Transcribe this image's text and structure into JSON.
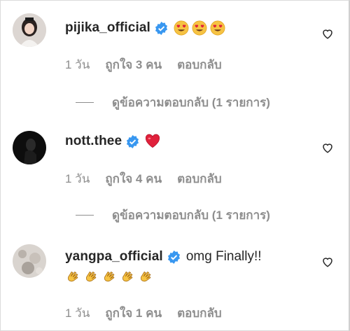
{
  "colors": {
    "verified": "#3897f0",
    "text": "#262626",
    "secondary": "#8e8e8e",
    "heart_emoji": "#e0213b",
    "clap_emoji": "#f6c343"
  },
  "comments": [
    {
      "username": "pijika_official",
      "verified": true,
      "text": "",
      "emoji": [
        "heart-eyes-emoji",
        "heart-eyes-emoji",
        "heart-eyes-emoji"
      ],
      "time": "1 วัน",
      "likes": "ถูกใจ 3 คน",
      "reply_label": "ตอบกลับ",
      "view_replies": "ดูข้อความตอบกลับ (1 รายการ)"
    },
    {
      "username": "nott.thee",
      "verified": true,
      "text": "",
      "emoji": [
        "red-heart-emoji"
      ],
      "time": "1 วัน",
      "likes": "ถูกใจ 4 คน",
      "reply_label": "ตอบกลับ",
      "view_replies": "ดูข้อความตอบกลับ (1 รายการ)"
    },
    {
      "username": "yangpa_official",
      "verified": true,
      "text": "omg Finally!!",
      "emoji": [
        "clapping-hands-emoji",
        "clapping-hands-emoji",
        "clapping-hands-emoji",
        "clapping-hands-emoji",
        "clapping-hands-emoji"
      ],
      "time": "1 วัน",
      "likes": "ถูกใจ 1 คน",
      "reply_label": "ตอบกลับ",
      "view_replies": ""
    }
  ]
}
